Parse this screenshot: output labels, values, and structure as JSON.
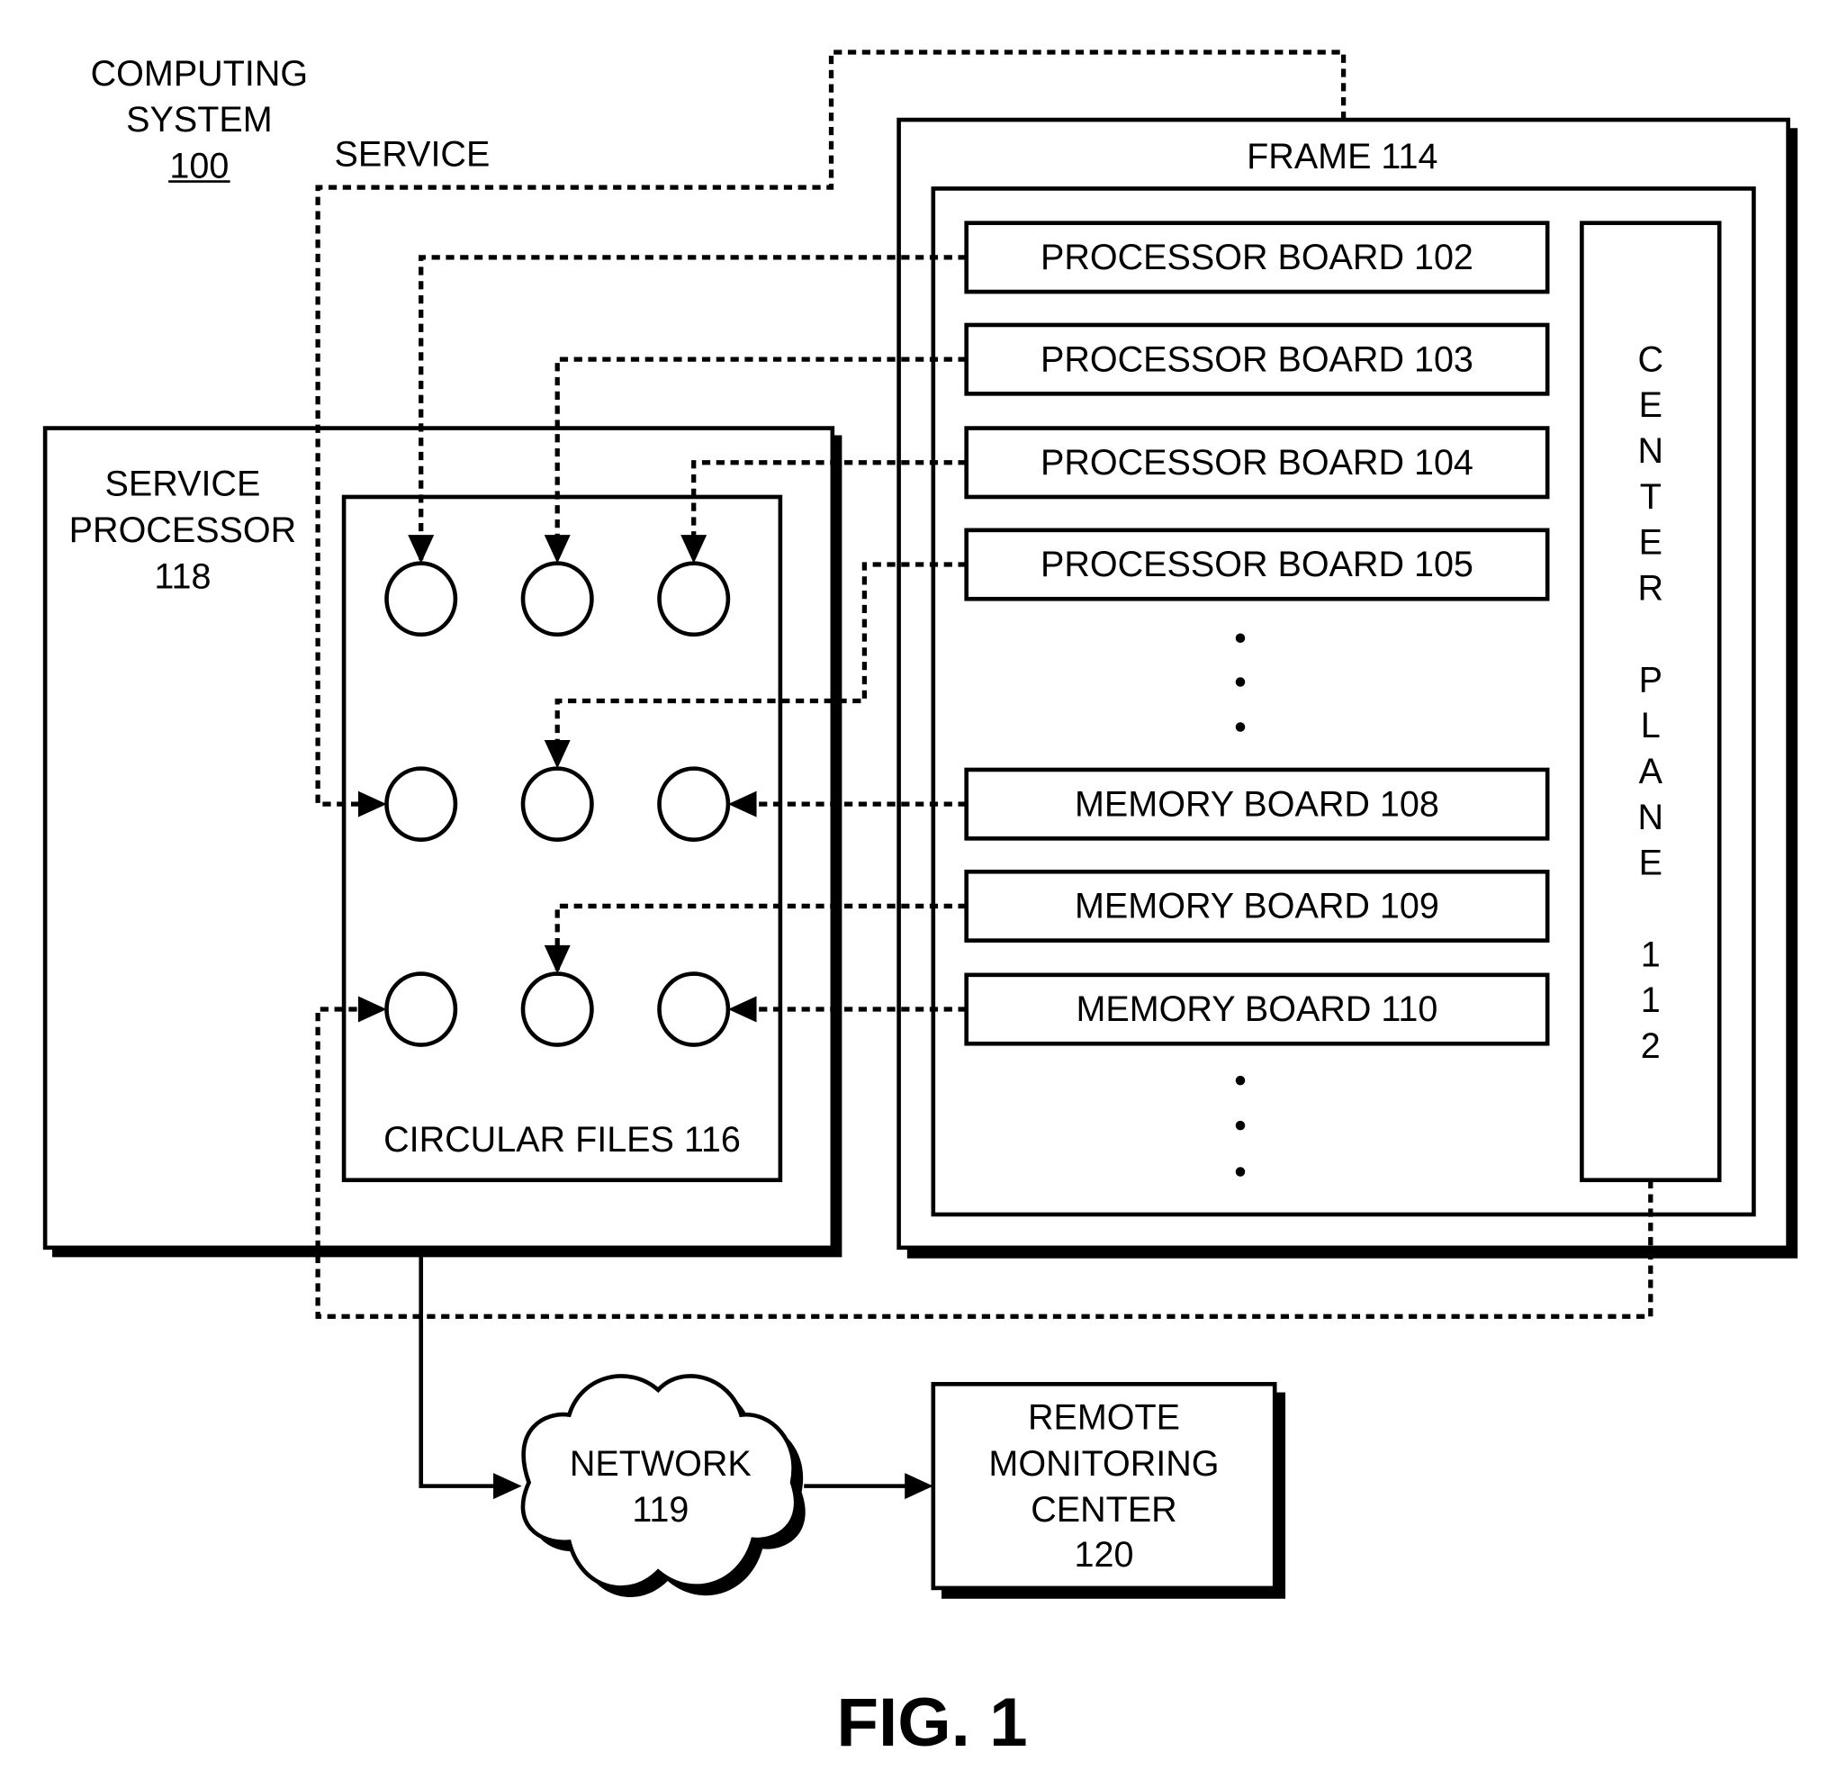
{
  "figure": {
    "caption": "FIG. 1",
    "system_label": [
      "COMPUTING",
      "SYSTEM"
    ],
    "system_ref": "100",
    "service_link_label": "SERVICE"
  },
  "service_processor": {
    "label": [
      "SERVICE",
      "PROCESSOR"
    ],
    "ref": "118",
    "circular_files": {
      "label": "CIRCULAR FILES  116",
      "file_count": 9,
      "grid": "3x3"
    }
  },
  "frame": {
    "label": "FRAME  114",
    "boards": [
      {
        "label": "PROCESSOR BOARD  102"
      },
      {
        "label": "PROCESSOR BOARD  103"
      },
      {
        "label": "PROCESSOR BOARD  104"
      },
      {
        "label": "PROCESSOR BOARD  105"
      },
      {
        "label": "MEMORY BOARD  108"
      },
      {
        "label": "MEMORY BOARD  109"
      },
      {
        "label": "MEMORY BOARD  110"
      }
    ],
    "ellipsis": "•",
    "center_plane": {
      "letters": [
        "C",
        "E",
        "N",
        "T",
        "E",
        "R",
        "",
        "P",
        "L",
        "A",
        "N",
        "E",
        "",
        "1",
        "1",
        "2"
      ]
    }
  },
  "network": {
    "label": "NETWORK",
    "ref": "119"
  },
  "remote_monitoring": {
    "label": [
      "REMOTE",
      "MONITORING",
      "CENTER"
    ],
    "ref": "120"
  }
}
